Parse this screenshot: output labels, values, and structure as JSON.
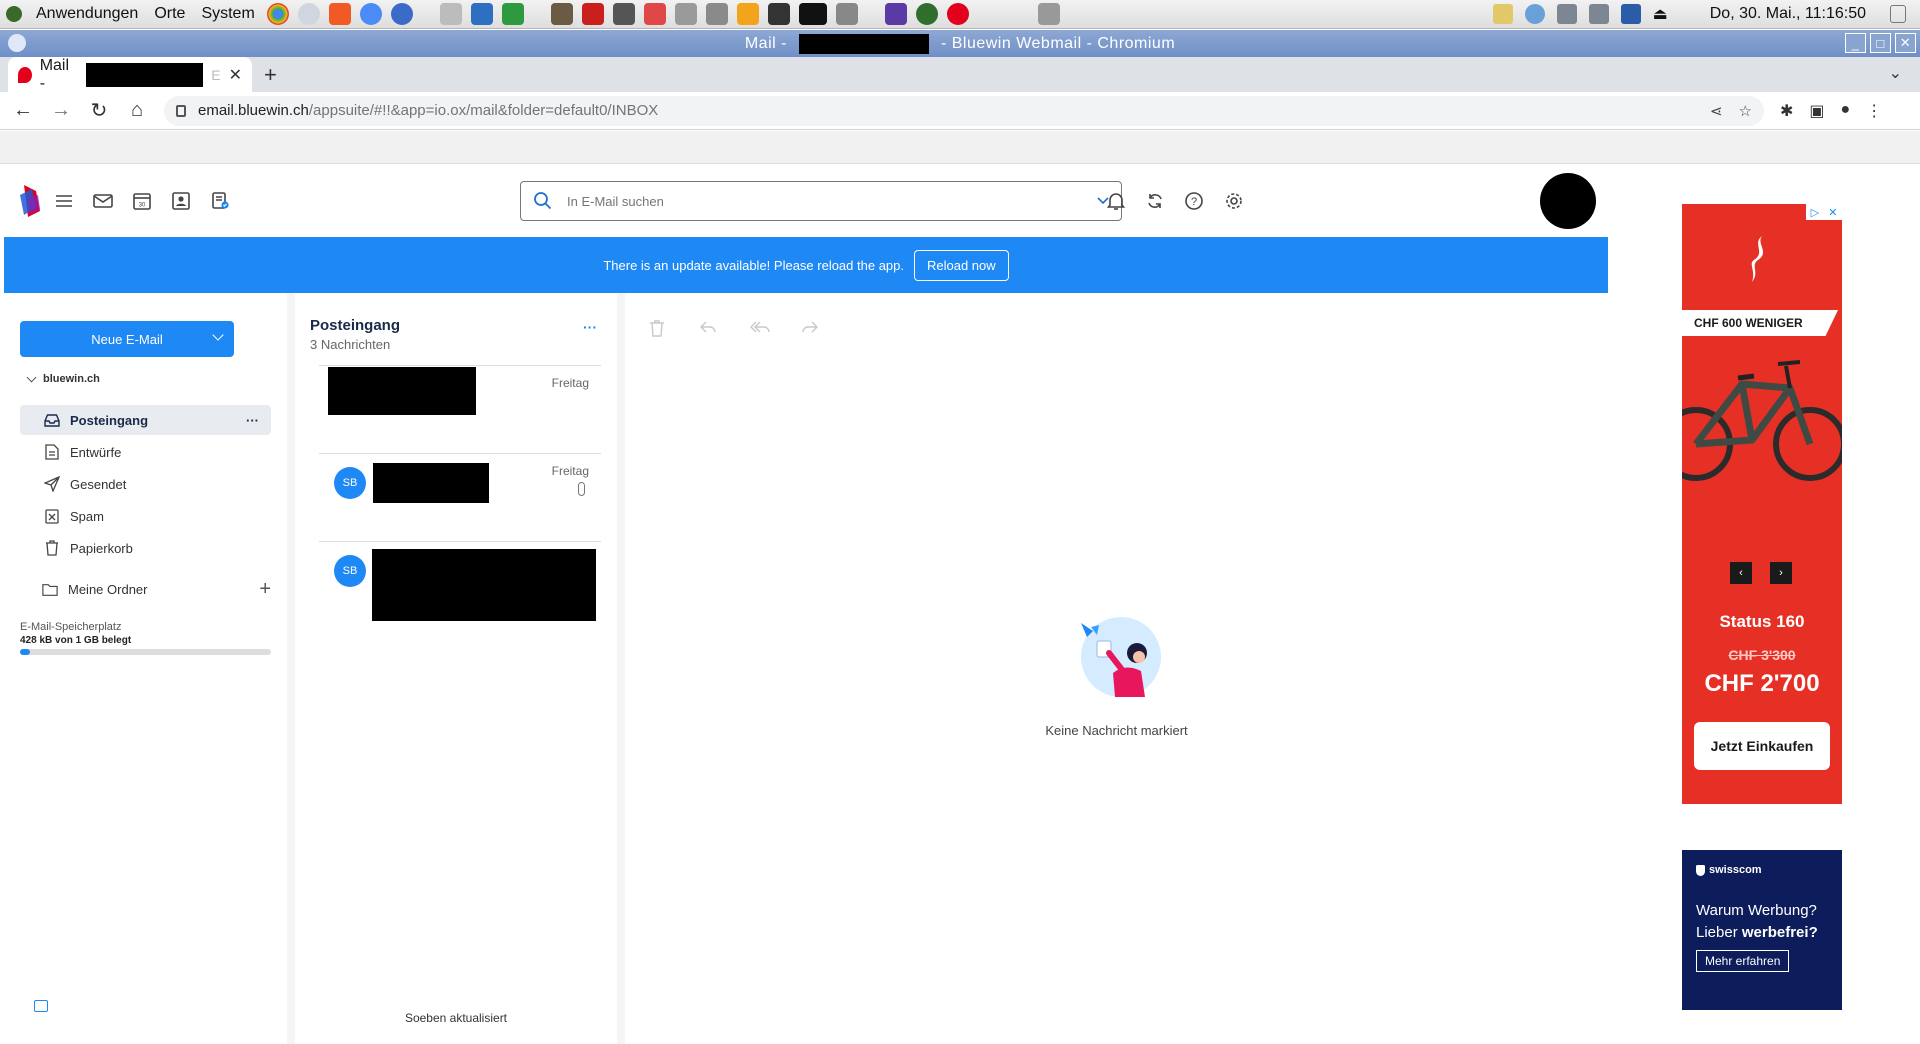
{
  "os_panel": {
    "menu": [
      "Anwendungen",
      "Orte",
      "System"
    ],
    "clock": "Do, 30. Mai., 11:16:50"
  },
  "window": {
    "title_prefix": "Mail -",
    "title_suffix": "- Bluewin Webmail - Chromium"
  },
  "browser": {
    "tab_title": "Mail -",
    "tab_fade": "E",
    "url_host": "email.bluewin.ch",
    "url_path": "/appsuite/#!!&app=io.ox/mail&folder=default0/INBOX"
  },
  "header": {
    "search_placeholder": "In E-Mail suchen"
  },
  "banner": {
    "message": "There is an update available! Please reload the app.",
    "reload_label": "Reload now"
  },
  "sidebar": {
    "compose_label": "Neue E-Mail",
    "account": "bluewin.ch",
    "folders": [
      {
        "label": "Posteingang",
        "icon": "inbox-icon"
      },
      {
        "label": "Entwürfe",
        "icon": "drafts-icon"
      },
      {
        "label": "Gesendet",
        "icon": "send-icon"
      },
      {
        "label": "Spam",
        "icon": "spam-icon"
      },
      {
        "label": "Papierkorb",
        "icon": "trash-icon"
      }
    ],
    "my_folders": "Meine Ordner",
    "quota_label": "E-Mail-Speicherplatz",
    "quota_value": "428 kB von 1 GB belegt",
    "quota_fraction": 0.04
  },
  "list": {
    "title": "Posteingang",
    "count": "3 Nachrichten",
    "messages": [
      {
        "date": "Freitag",
        "avatar": "",
        "attachment": false
      },
      {
        "date": "Freitag",
        "avatar": "SB",
        "attachment": true
      },
      {
        "date": "",
        "avatar": "SB",
        "attachment": false
      }
    ],
    "footer": "Soeben aktualisiert"
  },
  "detail": {
    "empty_text": "Keine Nachricht markiert"
  },
  "ads": {
    "ad1": {
      "tag": "CHF 600 WENIGER",
      "model": "Status 160",
      "old_price": "CHF 3'300",
      "new_price": "CHF 2'700",
      "cta": "Jetzt Einkaufen"
    },
    "ad2": {
      "brand": "swisscom",
      "line1": "Warum Werbung?",
      "line2_prefix": "Lieber",
      "line2_bold": "werbefrei?",
      "cta": "Mehr erfahren"
    }
  },
  "colors": {
    "accent": "#1e88f5",
    "ad_red": "#e63025",
    "ad_navy": "#0d1c5a"
  }
}
